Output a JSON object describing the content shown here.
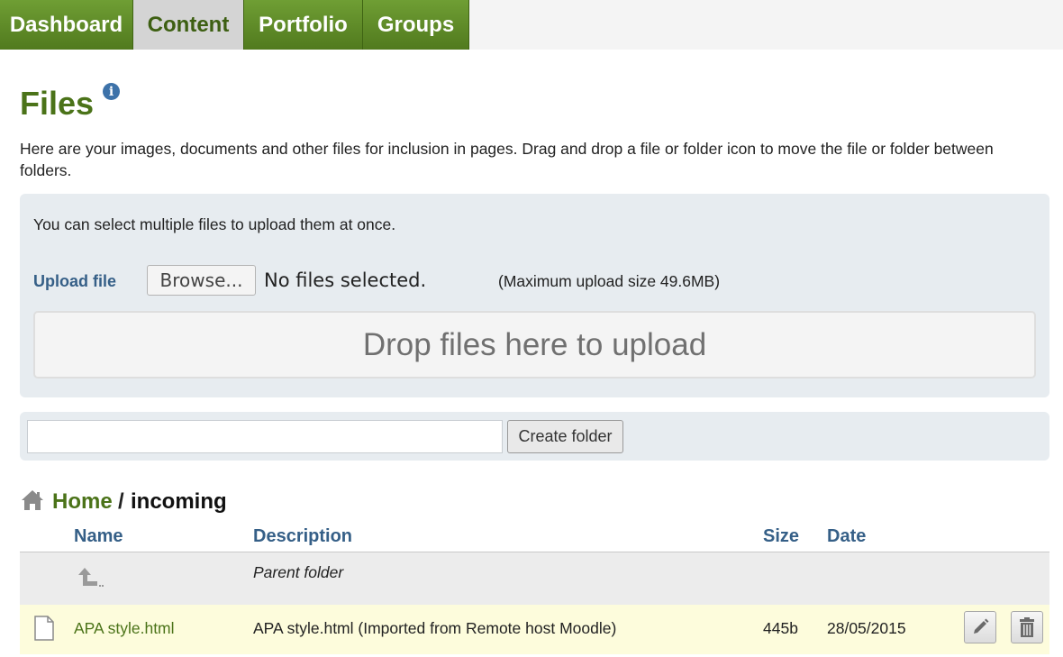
{
  "nav": {
    "tabs": [
      {
        "label": "Dashboard",
        "active": false
      },
      {
        "label": "Content",
        "active": true
      },
      {
        "label": "Portfolio",
        "active": false
      },
      {
        "label": "Groups",
        "active": false
      }
    ]
  },
  "page": {
    "title": "Files",
    "info_icon": "info-icon",
    "intro": "Here are your images, documents and other files for inclusion in pages. Drag and drop a file or folder icon to move the file or folder between folders."
  },
  "upload": {
    "hint": "You can select multiple files to upload them at once.",
    "label": "Upload file",
    "browse_label": "Browse...",
    "selection_status": "No files selected.",
    "max_size": "(Maximum upload size 49.6MB)",
    "dropzone_text": "Drop files here to upload"
  },
  "folder": {
    "input_value": "",
    "create_label": "Create folder"
  },
  "breadcrumb": {
    "home_icon": "home-icon",
    "home": "Home",
    "separator": "/",
    "current": "incoming"
  },
  "table": {
    "columns": {
      "name": "Name",
      "description": "Description",
      "size": "Size",
      "date": "Date"
    },
    "parent_row": {
      "icon": "parent-folder-icon",
      "label": "Parent folder"
    },
    "rows": [
      {
        "icon": "file-icon",
        "name": "APA style.html",
        "description": "APA style.html (Imported from Remote host Moodle)",
        "size": "445b",
        "date": "28/05/2015",
        "actions": [
          "edit-icon",
          "delete-icon"
        ]
      }
    ]
  },
  "colors": {
    "brand_green": "#4b7319",
    "tab_green": "#6f9e34",
    "heading_blue": "#355f87",
    "panel_bg": "#e7ecf0",
    "highlight_row": "#fdfcdc"
  }
}
